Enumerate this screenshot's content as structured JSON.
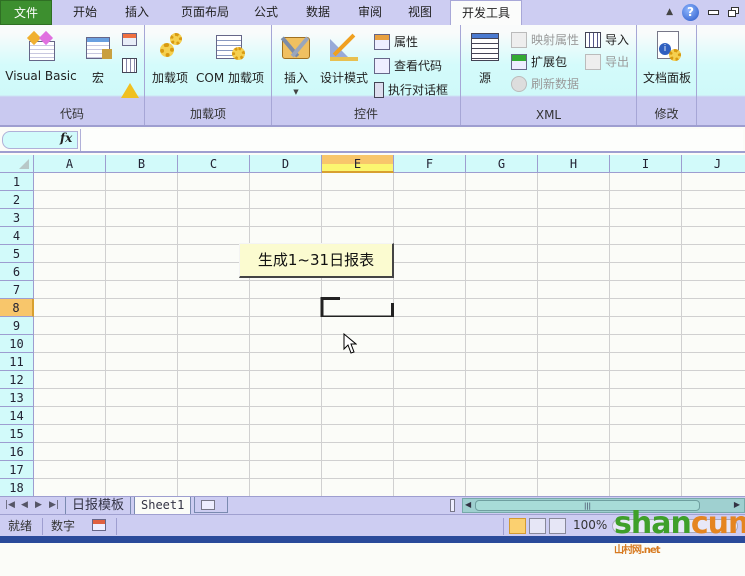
{
  "tabs": {
    "file": "文件",
    "items": [
      "开始",
      "插入",
      "页面布局",
      "公式",
      "数据",
      "审阅",
      "视图",
      "开发工具"
    ],
    "active": "开发工具"
  },
  "window_controls": {
    "minimize_ribbon": "caret-up-icon",
    "help": "?",
    "minimize": "minimize-icon",
    "restore": "restore-icon"
  },
  "ribbon": {
    "groups": {
      "code": {
        "label": "代码",
        "visual_basic": "Visual Basic",
        "macros": "宏"
      },
      "addins": {
        "label": "加载项",
        "addins": "加载项",
        "com_addins": "COM 加载项"
      },
      "controls": {
        "label": "控件",
        "insert": "插入",
        "design_mode": "设计模式",
        "properties": "属性",
        "view_code": "查看代码",
        "run_dialog": "执行对话框"
      },
      "xml": {
        "label": "XML",
        "source": "源",
        "map_properties": "映射属性",
        "expansion_packs": "扩展包",
        "refresh_data": "刷新数据",
        "import": "导入",
        "export": "导出"
      },
      "modify": {
        "label": "修改",
        "document_panel": "文档面板"
      }
    }
  },
  "formula_bar": {
    "name_box": "",
    "fx": "fx",
    "formula": ""
  },
  "grid": {
    "columns": [
      "A",
      "B",
      "C",
      "D",
      "E",
      "F",
      "G",
      "H",
      "I",
      "J"
    ],
    "rows": [
      "1",
      "2",
      "3",
      "4",
      "5",
      "6",
      "7",
      "8",
      "9",
      "10",
      "11",
      "12",
      "13",
      "14",
      "15",
      "16",
      "17",
      "18"
    ],
    "selected_column": "E",
    "selected_row": "8",
    "macro_button_label": "生成1~31日报表"
  },
  "sheets": {
    "tabs": [
      "日报模板",
      "Sheet1"
    ],
    "active": "Sheet1"
  },
  "status": {
    "ready": "就绪",
    "num": "数字",
    "zoom": "100%"
  },
  "watermark": {
    "text_green": "shan",
    "text_orange": "cun",
    "suffix": "山村网.net"
  },
  "colors": {
    "file_tab": "#3d8f2f",
    "ribbon_bg": "#d4fbfb",
    "group_label_bg": "#c9c9f0",
    "header_bg": "#d2fafa",
    "selected_header": "#f8c66b",
    "macro_button_bg": "#fbfbd0"
  }
}
